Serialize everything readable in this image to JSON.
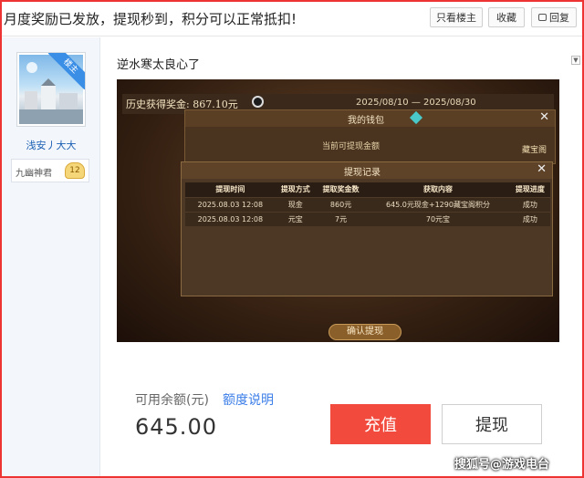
{
  "header": {
    "title": "月度奖励已发放，提现秒到，积分可以正常抵扣!",
    "btn_only_author": "只看楼主",
    "btn_favorite": "收藏",
    "btn_reply": "回复"
  },
  "sidebar": {
    "badge": "楼主",
    "username": "浅安丿大大",
    "rank_name": "九幽神君",
    "level": "12"
  },
  "post": {
    "text": "逆水寒太良心了"
  },
  "game_screenshot": {
    "history_label": "历史获得奖金: 867.10元",
    "date_range": "2025/08/10 — 2025/08/30",
    "wallet_title": "我的钱包",
    "wallet_sub": "当前可提现金额",
    "side_label": "藏宝阁",
    "records_title": "提现记录",
    "columns": [
      "提现时间",
      "提现方式",
      "提取奖金数",
      "获取内容",
      "提现进度"
    ],
    "rows": [
      [
        "2025.08.03  12:08",
        "现金",
        "860元",
        "645.0元现金+1290藏宝阁积分",
        "成功"
      ],
      [
        "2025.08.03  12:08",
        "元宝",
        "7元",
        "70元宝",
        "成功"
      ]
    ],
    "confirm": "确认提现"
  },
  "balance": {
    "label": "可用余额(元)",
    "help": "额度说明",
    "value": "645.00",
    "recharge": "充值",
    "withdraw": "提现"
  },
  "watermark": "搜狐号@游戏电台"
}
